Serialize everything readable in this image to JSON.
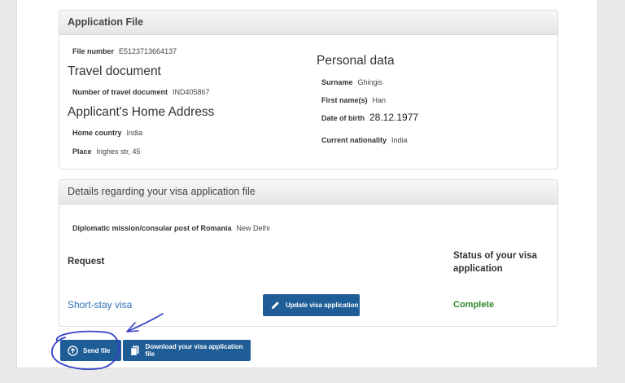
{
  "application_file": {
    "header": "Application File",
    "file_number_label": "File number",
    "file_number": "E5123713664137",
    "travel_document": {
      "title": "Travel document",
      "number_label": "Number of travel document",
      "number": "IND405867"
    },
    "home_address": {
      "title": "Applicant's Home Address",
      "country_label": "Home country",
      "country": "India",
      "place_label": "Place",
      "place": "Irighes str, 45"
    },
    "personal_data": {
      "title": "Personal data",
      "surname_label": "Surname",
      "surname": "Ghingis",
      "first_name_label": "First name(s)",
      "first_name": "Han",
      "dob_label": "Date of birth",
      "dob": "28.12.1977",
      "nationality_label": "Current nationality",
      "nationality": "India"
    }
  },
  "details": {
    "header": "Details regarding your visa application file",
    "mission_label": "Diplomatic mission/consular post of Romania",
    "mission": "New Delhi",
    "request_header": "Request",
    "status_header": "Status of your visa application",
    "request_link": "Short-stay visa",
    "update_button": "Update visa application",
    "status": "Complete"
  },
  "actions": {
    "send_button": "Send file",
    "download_button": "Download your visa application file"
  },
  "colors": {
    "primary_button": "#1f5d96",
    "link": "#2e70b6",
    "status_complete": "#2e8a2e",
    "annotation": "#3340c6"
  },
  "icons": {
    "send": "upload-circle-icon",
    "download": "document-icon",
    "update": "pencil-icon"
  }
}
